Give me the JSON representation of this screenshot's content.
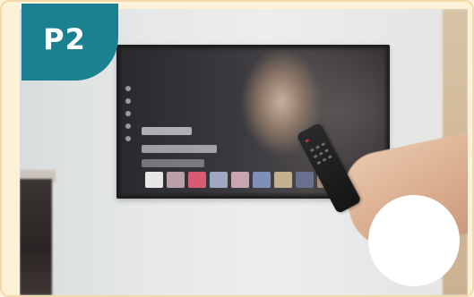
{
  "badge": {
    "label": "P2"
  },
  "colors": {
    "badge": "#1b8191",
    "frame": "#fdf1d8",
    "border": "#f3d9a8"
  },
  "scene": {
    "subject": "hand-holding-tv-remote",
    "tv": "blurred-tv-screen",
    "overlay": "white-circle"
  }
}
